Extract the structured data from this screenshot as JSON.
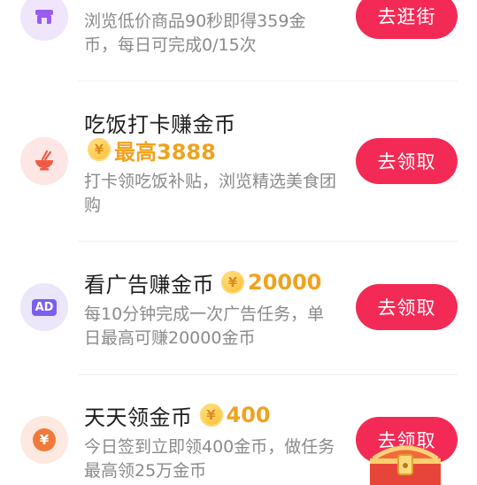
{
  "tasks": [
    {
      "icon": "shop-icon",
      "icon_bg": "#efe6fb",
      "icon_color": "#9a5cf0",
      "desc": "浏览低价商品90秒即得359金币，每日可完成0/15次",
      "button": "去逛街"
    },
    {
      "icon": "bowl-icon",
      "icon_bg": "#fde6e3",
      "icon_color": "#f05a45",
      "title": "吃饭打卡赚金币",
      "reward_text": "最高3888",
      "desc": "打卡领吃饭补贴，浏览精选美食团购",
      "button": "去领取"
    },
    {
      "icon": "ad-icon",
      "icon_bg": "#ece6fb",
      "icon_color": "#7b5ef0",
      "icon_text": "AD",
      "title": "看广告赚金币",
      "reward_text": "20000",
      "desc": "每10分钟完成一次广告任务，单日最高可赚20000金币",
      "button": "去领取"
    },
    {
      "icon": "yen-coin-icon",
      "icon_bg": "#fde9e0",
      "icon_color": "#f07a3a",
      "icon_text": "¥",
      "title": "天天领金币",
      "reward_text": "400",
      "desc": "今日签到立即领400金币，做任务最高领25万金币",
      "button": "去领取"
    }
  ],
  "coin_symbol": "¥",
  "colors": {
    "accent": "#f32a55",
    "reward": "#f0a21e",
    "desc": "#8a8a8a"
  }
}
